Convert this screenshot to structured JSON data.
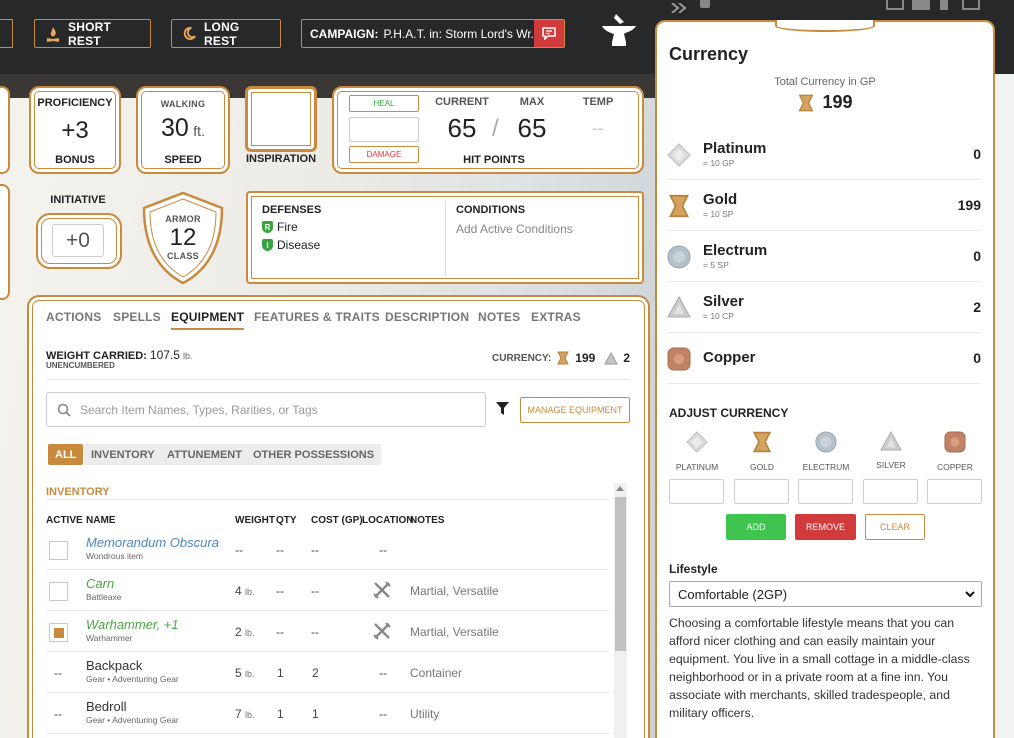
{
  "topbar": {
    "short_rest": "SHORT REST",
    "long_rest": "LONG REST",
    "campaign_label": "CAMPAIGN:",
    "campaign_value": "P.H.A.T. in: Storm Lord's Wr..."
  },
  "stats": {
    "proficiency_label": "PROFICIENCY",
    "proficiency_value": "+3",
    "proficiency_footer": "BONUS",
    "walking_label": "WALKING",
    "speed_value": "30",
    "speed_unit": "ft.",
    "speed_footer": "SPEED",
    "inspiration_label": "INSPIRATION",
    "initiative_label": "INITIATIVE",
    "initiative_value": "+0",
    "armor_label": "ARMOR",
    "armor_value": "12",
    "armor_footer": "CLASS"
  },
  "hp": {
    "heal_label": "HEAL",
    "damage_label": "DAMAGE",
    "current_label": "CURRENT",
    "max_label": "MAX",
    "temp_label": "TEMP",
    "current_value": "65",
    "separator": "/",
    "max_value": "65",
    "temp_value": "--",
    "footer": "HIT POINTS"
  },
  "defenses": {
    "title": "DEFENSES",
    "items": [
      {
        "badge": "R",
        "label": "Fire",
        "badge_color": "#3aa443"
      },
      {
        "badge": "I",
        "label": "Disease",
        "badge_color": "#3aa443"
      }
    ]
  },
  "conditions": {
    "title": "CONDITIONS",
    "placeholder": "Add Active Conditions"
  },
  "tabs": [
    "ACTIONS",
    "SPELLS",
    "EQUIPMENT",
    "FEATURES & TRAITS",
    "DESCRIPTION",
    "NOTES",
    "EXTRAS"
  ],
  "equipment": {
    "weight_label": "WEIGHT CARRIED:",
    "weight_value": "107.5",
    "weight_unit": "lb.",
    "encumbrance": "UNENCUMBERED",
    "currency_label": "CURRENCY:",
    "currency_gold": "199",
    "currency_silver": "2",
    "search_placeholder": "Search Item Names, Types, Rarities, or Tags",
    "manage_label": "MANAGE EQUIPMENT",
    "filters": [
      "ALL",
      "INVENTORY",
      "ATTUNEMENT",
      "OTHER POSSESSIONS"
    ],
    "section_title": "INVENTORY",
    "columns": [
      "ACTIVE",
      "NAME",
      "WEIGHT",
      "QTY",
      "COST (GP)",
      "LOCATION",
      "NOTES"
    ],
    "rows": [
      {
        "active": "",
        "name": "Memorandum Obscura",
        "type": "Wondrous item",
        "weight": "--",
        "unit": "",
        "qty": "--",
        "cost": "--",
        "location": "--",
        "notes": "",
        "color": "#4a86c5"
      },
      {
        "active": "",
        "name": "Carn",
        "type": "Battleaxe",
        "weight": "4",
        "unit": "lb.",
        "qty": "--",
        "cost": "--",
        "location": "",
        "notes": "Martial, Versatile",
        "color": "#4aa544"
      },
      {
        "active": "",
        "name": "Warhammer, +1",
        "type": "Warhammer",
        "weight": "2",
        "unit": "lb.",
        "qty": "--",
        "cost": "--",
        "location": "",
        "notes": "Martial, Versatile",
        "color": "#4aa544"
      },
      {
        "active": "--",
        "name": "Backpack",
        "type": "Gear • Adventuring Gear",
        "weight": "5",
        "unit": "lb.",
        "qty": "1",
        "cost": "2",
        "location": "--",
        "notes": "Container",
        "color": "#333333"
      },
      {
        "active": "--",
        "name": "Bedroll",
        "type": "Gear • Adventuring Gear",
        "weight": "7",
        "unit": "lb.",
        "qty": "1",
        "cost": "1",
        "location": "--",
        "notes": "Utility",
        "color": "#333333"
      }
    ]
  },
  "currency_panel": {
    "title": "Currency",
    "total_label": "Total Currency in GP",
    "total_value": "199",
    "coins": [
      {
        "name": "Platinum",
        "rate": "= 10 GP",
        "value": "0"
      },
      {
        "name": "Gold",
        "rate": "= 10 SP",
        "value": "199"
      },
      {
        "name": "Electrum",
        "rate": "= 5 SP",
        "value": "0"
      },
      {
        "name": "Silver",
        "rate": "= 10 CP",
        "value": "2"
      },
      {
        "name": "Copper",
        "rate": "",
        "value": "0"
      }
    ],
    "adjust_title": "ADJUST CURRENCY",
    "adjust_labels": [
      "PLATINUM",
      "GOLD",
      "ELECTRUM",
      "SILVER",
      "COPPER"
    ],
    "add_label": "ADD",
    "remove_label": "REMOVE",
    "clear_label": "CLEAR",
    "lifestyle_label": "Lifestyle",
    "lifestyle_value": "Comfortable (2GP)",
    "lifestyle_text": "Choosing a comfortable lifestyle means that you can afford nicer clothing and can easily maintain your equipment. You live in a small cottage in a middle-class neighborhood or in a private room at a fine inn. You associate with merchants, skilled tradespeople, and military officers."
  },
  "colors": {
    "accent": "#c98a3e",
    "add": "#3fc44f",
    "remove": "#d13b3b"
  }
}
